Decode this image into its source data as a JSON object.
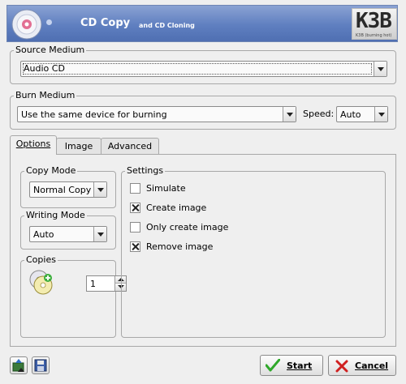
{
  "header": {
    "title": "CD Copy",
    "subtitle": "and CD Cloning",
    "logo_text": "K3B",
    "logo_tagline": "K3B (burning hot)"
  },
  "source_medium": {
    "title": "Source Medium",
    "selected": "Audio CD"
  },
  "burn_medium": {
    "title": "Burn Medium",
    "device": "Use the same device for burning",
    "speed_label": "Speed:",
    "speed_value": "Auto"
  },
  "tabs": [
    {
      "label": "Options",
      "active": true
    },
    {
      "label": "Image",
      "active": false
    },
    {
      "label": "Advanced",
      "active": false
    }
  ],
  "copy_mode": {
    "title": "Copy Mode",
    "value": "Normal Copy"
  },
  "writing_mode": {
    "title": "Writing Mode",
    "value": "Auto"
  },
  "copies": {
    "title": "Copies",
    "value": "1"
  },
  "settings": {
    "title": "Settings",
    "options": [
      {
        "label": "Simulate",
        "checked": false
      },
      {
        "label": "Create image",
        "checked": true
      },
      {
        "label": "Only create image",
        "checked": false
      },
      {
        "label": "Remove image",
        "checked": true
      }
    ]
  },
  "buttons": {
    "start": "Start",
    "cancel": "Cancel"
  },
  "colors": {
    "banner": "#5f7fc0",
    "start_check": "#2fa82a",
    "cancel_x": "#d02020"
  },
  "icons": {
    "cd": "cd-copy-icon",
    "copies": "cd-stack-icon",
    "load_settings": "load-settings-icon",
    "save_settings": "save-settings-icon",
    "start": "green-check-icon",
    "cancel": "red-x-icon"
  }
}
